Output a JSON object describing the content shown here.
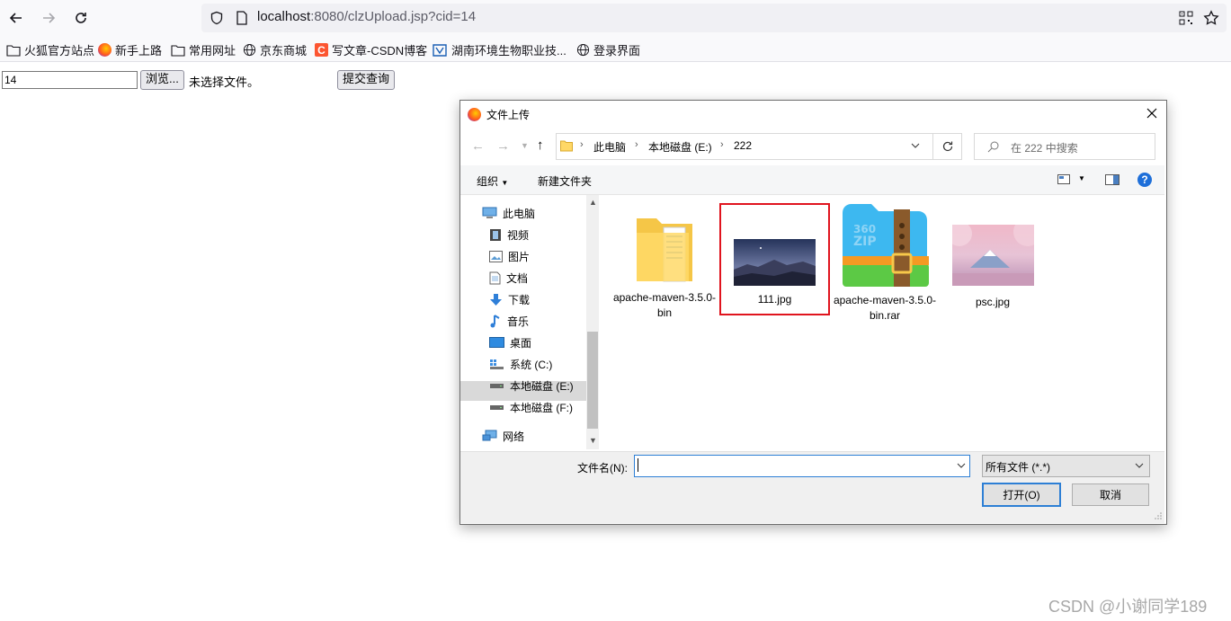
{
  "browser": {
    "url_host": "localhost",
    "url_rest": ":8080/clzUpload.jsp?cid=14",
    "bookmarks": [
      "火狐官方站点",
      "新手上路",
      "常用网址",
      "京东商城",
      "写文章-CSDN博客",
      "湖南环境生物职业技...",
      "登录界面"
    ]
  },
  "page": {
    "cid_value": "14",
    "browse_label": "浏览...",
    "no_file_label": "未选择文件。",
    "submit_label": "提交查询"
  },
  "dialog": {
    "title": "文件上传",
    "breadcrumb": [
      "此电脑",
      "本地磁盘 (E:)",
      "222"
    ],
    "search_placeholder": "在 222 中搜索",
    "organize_label": "组织",
    "new_folder_label": "新建文件夹",
    "nav_items": [
      "此电脑",
      "视频",
      "图片",
      "文档",
      "下载",
      "音乐",
      "桌面",
      "系统 (C:)",
      "本地磁盘 (E:)",
      "本地磁盘 (F:)",
      "网络"
    ],
    "selected_nav": "本地磁盘 (E:)",
    "files": [
      {
        "name": "apache-maven-3.5.0-bin",
        "icon": "folder-icon"
      },
      {
        "name": "111.jpg",
        "icon": "image-thumbnail",
        "highlighted": true
      },
      {
        "name": "apache-maven-3.5.0-bin.rar",
        "icon": "zip-archive-icon"
      },
      {
        "name": "psc.jpg",
        "icon": "image-thumbnail"
      }
    ],
    "filename_label": "文件名(N):",
    "filename_value": "",
    "filetype_value": "所有文件 (*.*)",
    "open_label": "打开(O)",
    "cancel_label": "取消",
    "highlight_color": "#e0141e"
  },
  "watermark": "CSDN @小谢同学189"
}
